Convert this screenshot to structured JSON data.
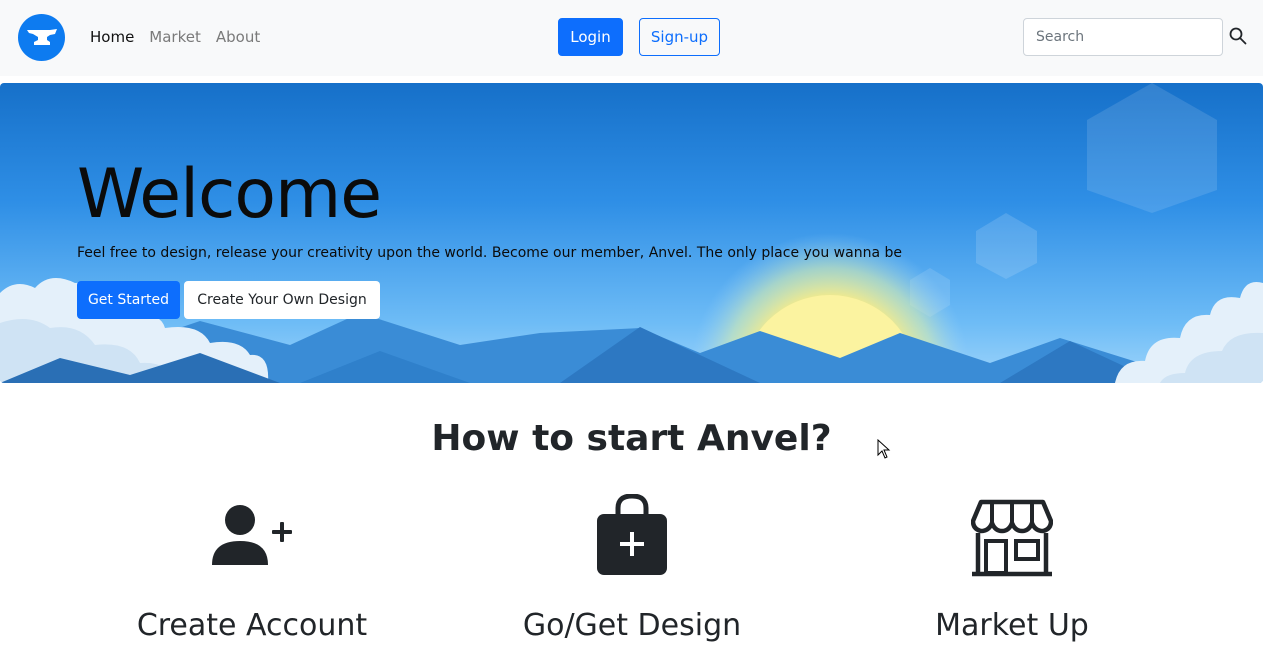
{
  "navbar": {
    "brand_icon": "anvil-icon",
    "links": [
      {
        "label": "Home",
        "active": true
      },
      {
        "label": "Market",
        "active": false
      },
      {
        "label": "About",
        "active": false
      }
    ],
    "login_label": "Login",
    "signup_label": "Sign-up",
    "search": {
      "placeholder": "Search",
      "value": "",
      "icon": "search-icon"
    }
  },
  "hero": {
    "title": "Welcome",
    "text": "Feel free to design, release your creativity upon the world. Become our member, Anvel. The only place you wanna be",
    "get_started_label": "Get Started",
    "create_design_label": "Create Your Own Design"
  },
  "steps": {
    "title": "How to start Anvel?",
    "items": [
      {
        "label": "Create Account",
        "icon": "person-plus-icon"
      },
      {
        "label": "Go/Get Design",
        "icon": "bag-plus-icon"
      },
      {
        "label": "Market Up",
        "icon": "shop-icon"
      }
    ]
  },
  "colors": {
    "primary": "#0d6efd",
    "brand_circle": "#0d7bf0",
    "navbar_bg": "#f8f9fa"
  }
}
